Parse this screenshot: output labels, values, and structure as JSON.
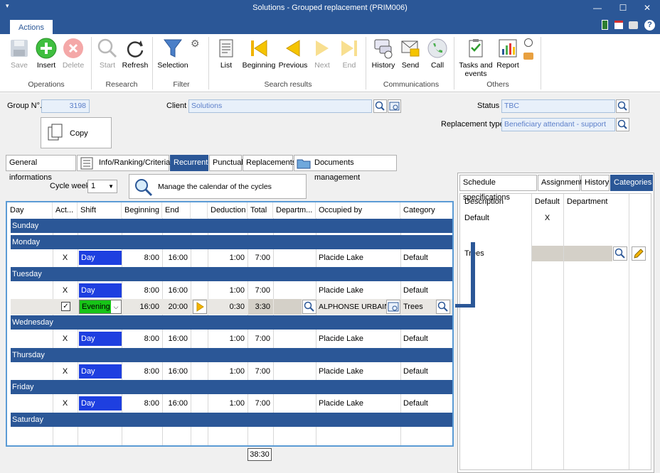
{
  "window": {
    "title": "Solutions - Grouped replacement (PRIM006)"
  },
  "ribbon_tab": "Actions",
  "ribbon": {
    "buttons": [
      {
        "label": "Save",
        "icon": "save-icon"
      },
      {
        "label": "Insert",
        "icon": "insert-icon"
      },
      {
        "label": "Delete",
        "icon": "delete-icon"
      },
      {
        "label": "Start",
        "icon": "start-icon"
      },
      {
        "label": "Refresh",
        "icon": "refresh-icon"
      },
      {
        "label": "Selection",
        "icon": "filter-icon"
      },
      {
        "label": "List",
        "icon": "list-icon"
      },
      {
        "label": "Beginning",
        "icon": "first-icon"
      },
      {
        "label": "Previous",
        "icon": "previous-icon"
      },
      {
        "label": "Next",
        "icon": "next-icon"
      },
      {
        "label": "End",
        "icon": "last-icon"
      },
      {
        "label": "History",
        "icon": "history-icon"
      },
      {
        "label": "Send",
        "icon": "send-icon"
      },
      {
        "label": "Call",
        "icon": "call-icon"
      },
      {
        "label": "Tasks and events",
        "icon": "tasks-icon"
      },
      {
        "label": "Report",
        "icon": "report-icon"
      }
    ],
    "groups": [
      "Operations",
      "Research",
      "Filter",
      "Search results",
      "Communications",
      "Others"
    ]
  },
  "form": {
    "group_label": "Group N°.",
    "group_value": "3198",
    "client_label": "Client",
    "client_value": "Solutions",
    "status_label": "Status",
    "status_value": "TBC",
    "replacement_label": "Replacement type",
    "replacement_value": "Beneficiary attendant - support",
    "copy_label": "Copy"
  },
  "tabs": [
    "General informations",
    "Info/Ranking/Criteria",
    "Recurrent",
    "Punctual",
    "Replacements",
    "Documents management"
  ],
  "cycle": {
    "label": "Cycle week",
    "value": "1",
    "calendar_label": "Manage the calendar of the cycles"
  },
  "grid": {
    "headers": [
      "Day",
      "Act...",
      "Shift",
      "Beginning",
      "End",
      "",
      "Deduction",
      "Total",
      "Departm...",
      "Occupied by",
      "Category"
    ],
    "days": {
      "sunday": "Sunday",
      "monday": "Monday",
      "tuesday": "Tuesday",
      "wednesday": "Wednesday",
      "thursday": "Thursday",
      "friday": "Friday",
      "saturday": "Saturday"
    },
    "rows": {
      "monday": {
        "act": "X",
        "shift": "Day",
        "begin": "8:00",
        "end": "16:00",
        "ded": "1:00",
        "total": "7:00",
        "occ": "Placide Lake",
        "cat": "Default"
      },
      "tuesday1": {
        "act": "X",
        "shift": "Day",
        "begin": "8:00",
        "end": "16:00",
        "ded": "1:00",
        "total": "7:00",
        "occ": "Placide Lake",
        "cat": "Default"
      },
      "tuesday2": {
        "shift": "Evening",
        "begin": "16:00",
        "end": "20:00",
        "ded": "0:30",
        "total": "3:30",
        "occ": "ALPHONSE URBAIN",
        "cat": "Trees"
      },
      "wednesday": {
        "act": "X",
        "shift": "Day",
        "begin": "8:00",
        "end": "16:00",
        "ded": "1:00",
        "total": "7:00",
        "occ": "Placide Lake",
        "cat": "Default"
      },
      "thursday": {
        "act": "X",
        "shift": "Day",
        "begin": "8:00",
        "end": "16:00",
        "ded": "1:00",
        "total": "7:00",
        "occ": "Placide Lake",
        "cat": "Default"
      },
      "friday": {
        "act": "X",
        "shift": "Day",
        "begin": "8:00",
        "end": "16:00",
        "ded": "1:00",
        "total": "7:00",
        "occ": "Placide Lake",
        "cat": "Default"
      }
    },
    "grand_total": "38:30"
  },
  "right": {
    "tabs": [
      "Schedule specifications",
      "Assignment",
      "History",
      "Categories"
    ],
    "headers": [
      "Description",
      "Default",
      "Department"
    ],
    "rows": [
      {
        "desc": "Default",
        "def": "X"
      },
      {
        "desc": "Trees",
        "def": ""
      }
    ]
  },
  "colors": {
    "accent": "#2b5797",
    "shift_day": "#1e3fe0",
    "shift_evening": "#17c417"
  }
}
